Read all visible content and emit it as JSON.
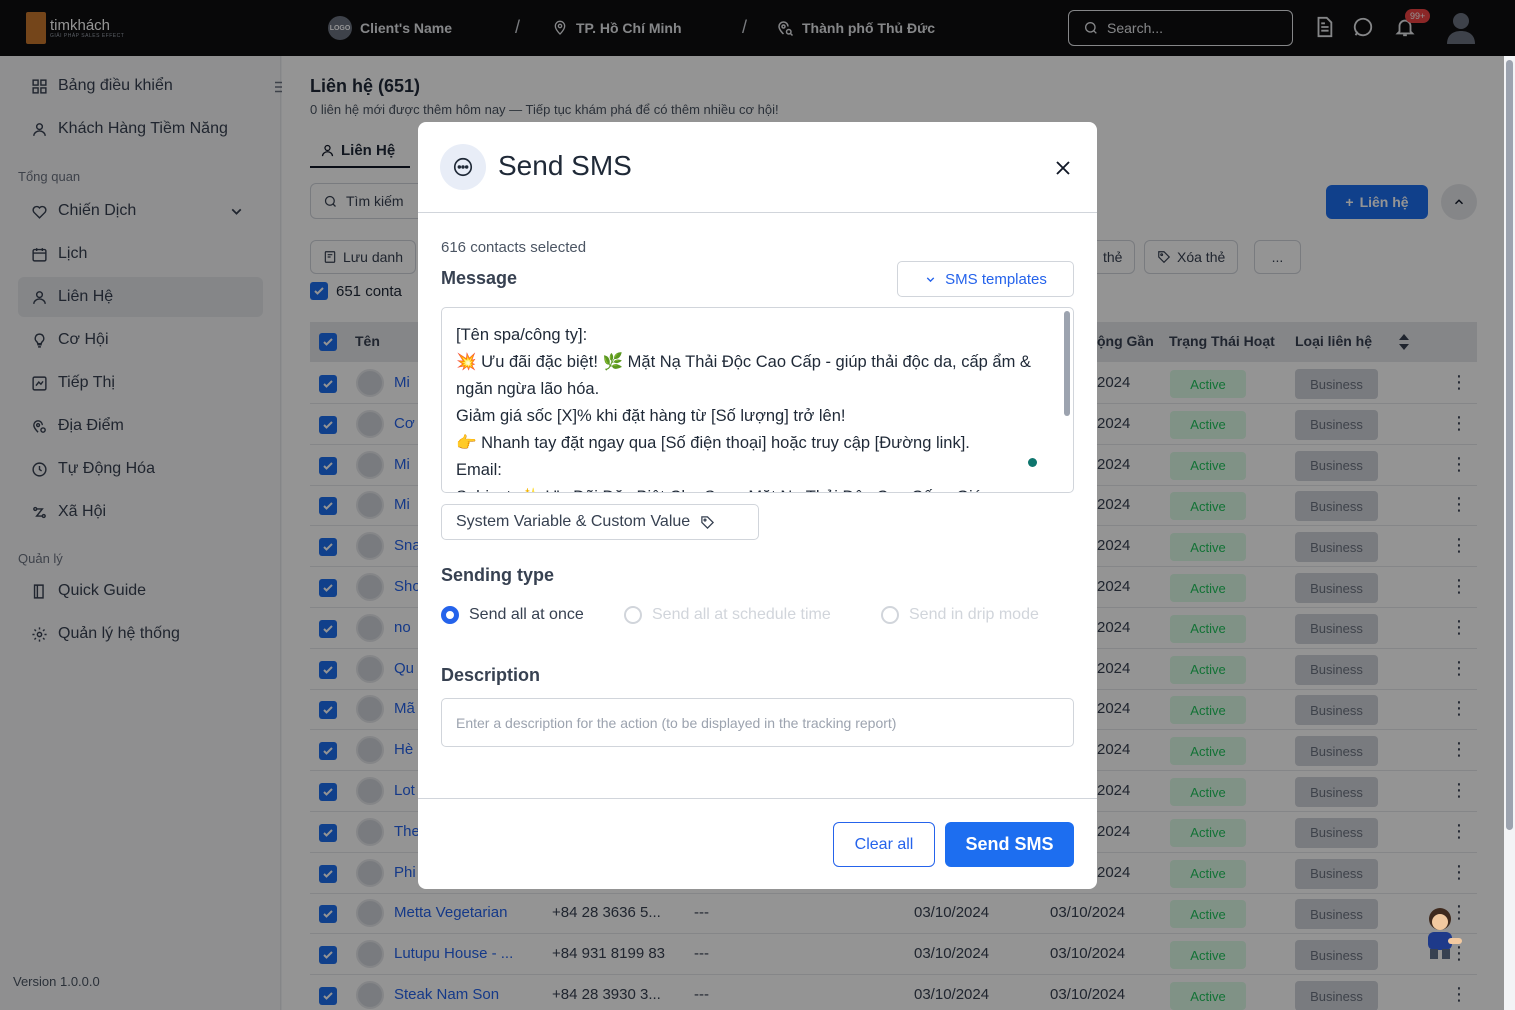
{
  "topbar": {
    "brand": "timkhách",
    "brand_sub": "GIẢI PHÁP SALES EFFECT",
    "logo_badge": "LOGO",
    "client_name": "Client's Name",
    "sep": "/",
    "city": "TP. Hồ Chí Minh",
    "district": "Thành phố Thủ Đức",
    "search_placeholder": "Search...",
    "notification_count": "99+"
  },
  "sidebar": {
    "items": [
      {
        "label": "Bảng điều khiển",
        "icon": "dashboard-grid-icon"
      },
      {
        "label": "Khách Hàng Tiềm Năng",
        "icon": "user-icon"
      },
      {
        "label": "Chiến Dịch",
        "icon": "campaign-icon"
      },
      {
        "label": "Lịch",
        "icon": "calendar-icon"
      },
      {
        "label": "Liên Hệ",
        "icon": "user-icon"
      },
      {
        "label": "Cơ Hội",
        "icon": "lightbulb-icon"
      },
      {
        "label": "Tiếp Thị",
        "icon": "marketing-icon"
      },
      {
        "label": "Địa Điểm",
        "icon": "location-icon"
      },
      {
        "label": "Tự Động Hóa",
        "icon": "automation-icon"
      },
      {
        "label": "Xã Hội",
        "icon": "social-icon"
      },
      {
        "label": "Quick Guide",
        "icon": "book-icon"
      },
      {
        "label": "Quản lý hệ thống",
        "icon": "gear-icon"
      }
    ],
    "section_overview": "Tổng quan",
    "section_manage": "Quản lý",
    "version": "Version 1.0.0.0"
  },
  "main": {
    "title": "Liên hệ (651)",
    "subtitle": "0 liên hệ mới được thêm hôm nay — Tiếp tục khám phá để có thêm nhiều cơ hội!",
    "tab": "Liên Hệ",
    "search": "Tìm kiếm",
    "save_list": "Lưu danh",
    "tag_btn": "thẻ",
    "delete_tag": "Xóa thẻ",
    "more": "...",
    "add_contact": "Liên hệ",
    "selected_count": "651 conta",
    "columns": {
      "name": "Tên",
      "recent": "ộng Gần",
      "status": "Trạng Thái Hoạt",
      "type": "Loại liên hệ"
    },
    "partial_rows": [
      {
        "name": "Mi",
        "year": "2024"
      },
      {
        "name": "Cơ",
        "year": "2024"
      },
      {
        "name": "Mi",
        "year": "2024"
      },
      {
        "name": "Mi",
        "year": "2024"
      },
      {
        "name": "Sna",
        "year": "2024"
      },
      {
        "name": "Sho",
        "year": "2024"
      },
      {
        "name": "no",
        "year": "2024"
      },
      {
        "name": "Qu",
        "year": "2024"
      },
      {
        "name": "Mã",
        "year": "2024"
      },
      {
        "name": "Hè",
        "year": "2024"
      },
      {
        "name": "Lot",
        "year": "2024"
      },
      {
        "name": "The",
        "year": "2024"
      },
      {
        "name": "Phi",
        "year": "2024"
      }
    ],
    "full_rows": [
      {
        "name": "Metta Vegetarian",
        "phone": "+84 28 3636 5...",
        "dash": "---",
        "date1": "03/10/2024",
        "date2": "03/10/2024"
      },
      {
        "name": "Lutupu House - ...",
        "phone": "+84 931 8199 83",
        "dash": "---",
        "date1": "03/10/2024",
        "date2": "03/10/2024"
      },
      {
        "name": "Steak Nam Son",
        "phone": "+84 28 3930 3...",
        "dash": "---",
        "date1": "03/10/2024",
        "date2": "03/10/2024"
      }
    ],
    "status_label": "Active",
    "type_label": "Business"
  },
  "modal": {
    "title": "Send SMS",
    "contacts_selected": "616 contacts selected",
    "message_label": "Message",
    "templates_btn": "SMS templates",
    "message_text": "[Tên spa/công ty]:\n💥 Ưu đãi đặc biệt! 🌿 Mặt Nạ Thải Độc Cao Cấp - giúp thải độc da, cấp ẩm & ngăn ngừa lão hóa.\nGiảm giá sốc [X]% khi đặt hàng từ [Số lượng] trở lên!\n👉 Nhanh tay đặt ngay qua [Số điện thoại] hoặc truy cập [Đường link].\nEmail:\nSubject: ✨ Ưu Đãi Đặc Biệt Cho Spa - Mặt Nạ Thải Độc Cao Cấp - Giá",
    "sysvar_btn": "System Variable & Custom Value",
    "sending_type_label": "Sending type",
    "sending_options": [
      "Send all at once",
      "Send all at schedule time",
      "Send in drip mode"
    ],
    "description_label": "Description",
    "description_placeholder": "Enter a description for the action (to be displayed in the tracking report)",
    "clear_btn": "Clear all",
    "send_btn": "Send SMS"
  }
}
